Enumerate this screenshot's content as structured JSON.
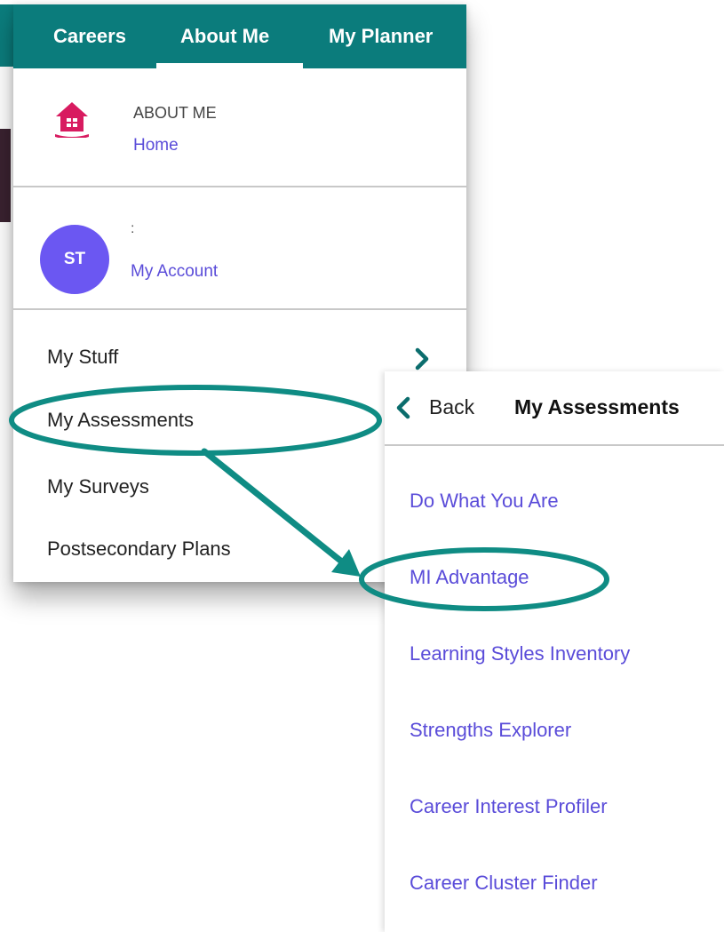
{
  "nav": {
    "tabs": [
      "Careers",
      "About Me",
      "My Planner"
    ],
    "active_tab": "About Me"
  },
  "about_section": {
    "heading": "ABOUT ME",
    "home_link": "Home",
    "icon": "house-icon"
  },
  "account": {
    "avatar_initials": "ST",
    "name": ":",
    "link": "My Account"
  },
  "menu": {
    "items": [
      "My Stuff",
      "My Assessments",
      "My Surveys",
      "Postsecondary Plans"
    ],
    "my_stuff_icon": "chevron-right-icon"
  },
  "submenu": {
    "back_label": "Back",
    "title": "My Assessments",
    "items": [
      "Do What You Are",
      "MI Advantage",
      "Learning Styles Inventory",
      "Strengths Explorer",
      "Career Interest Profiler",
      "Career Cluster Finder"
    ]
  },
  "colors": {
    "nav_teal": "#0b7c7c",
    "link_purple": "#5a4cd9",
    "avatar_purple": "#6b57f2",
    "house_pink": "#d81b60",
    "annotation_teal": "#0f8c84"
  }
}
